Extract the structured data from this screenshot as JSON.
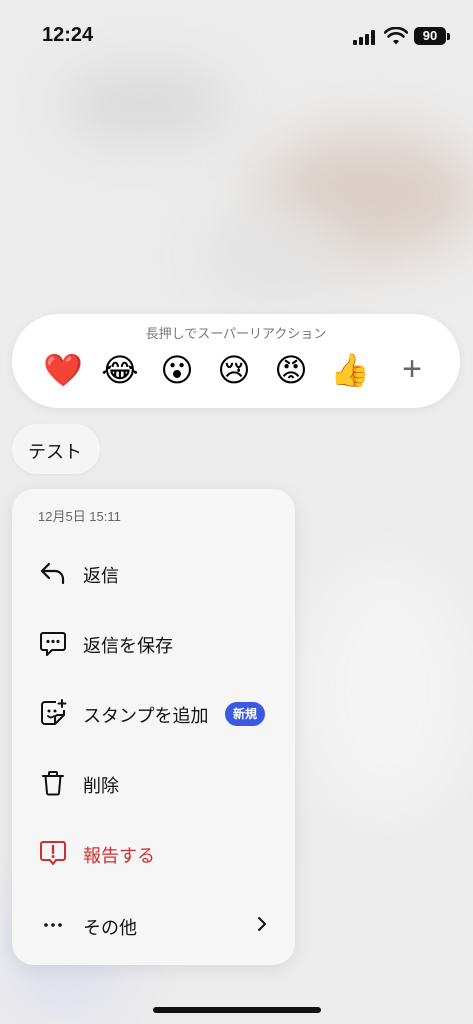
{
  "status_bar": {
    "time": "12:24",
    "battery": "90"
  },
  "reactions": {
    "hint": "長押しでスーパーリアクション",
    "emojis": [
      {
        "name": "heart",
        "glyph": "❤️"
      },
      {
        "name": "joy",
        "glyph": "😂"
      },
      {
        "name": "astonished",
        "glyph": "😮"
      },
      {
        "name": "crying",
        "glyph": "😢"
      },
      {
        "name": "angry",
        "glyph": "😡"
      },
      {
        "name": "thumbs-up",
        "glyph": "👍"
      }
    ],
    "more": "+"
  },
  "message": {
    "text": "テスト"
  },
  "menu": {
    "date": "12月5日 15:11",
    "items": [
      {
        "label": "返信",
        "icon": "reply-icon"
      },
      {
        "label": "返信を保存",
        "icon": "chat-bubble-icon"
      },
      {
        "label": "スタンプを追加",
        "icon": "sticker-add-icon",
        "badge": "新規"
      },
      {
        "label": "削除",
        "icon": "trash-icon"
      },
      {
        "label": "報告する",
        "icon": "report-icon",
        "color": "#d12f2f"
      },
      {
        "label": "その他",
        "icon": "more-dots-icon"
      }
    ]
  },
  "colors": {
    "accent_badge": "#3a5be0",
    "danger": "#d12f2f"
  }
}
